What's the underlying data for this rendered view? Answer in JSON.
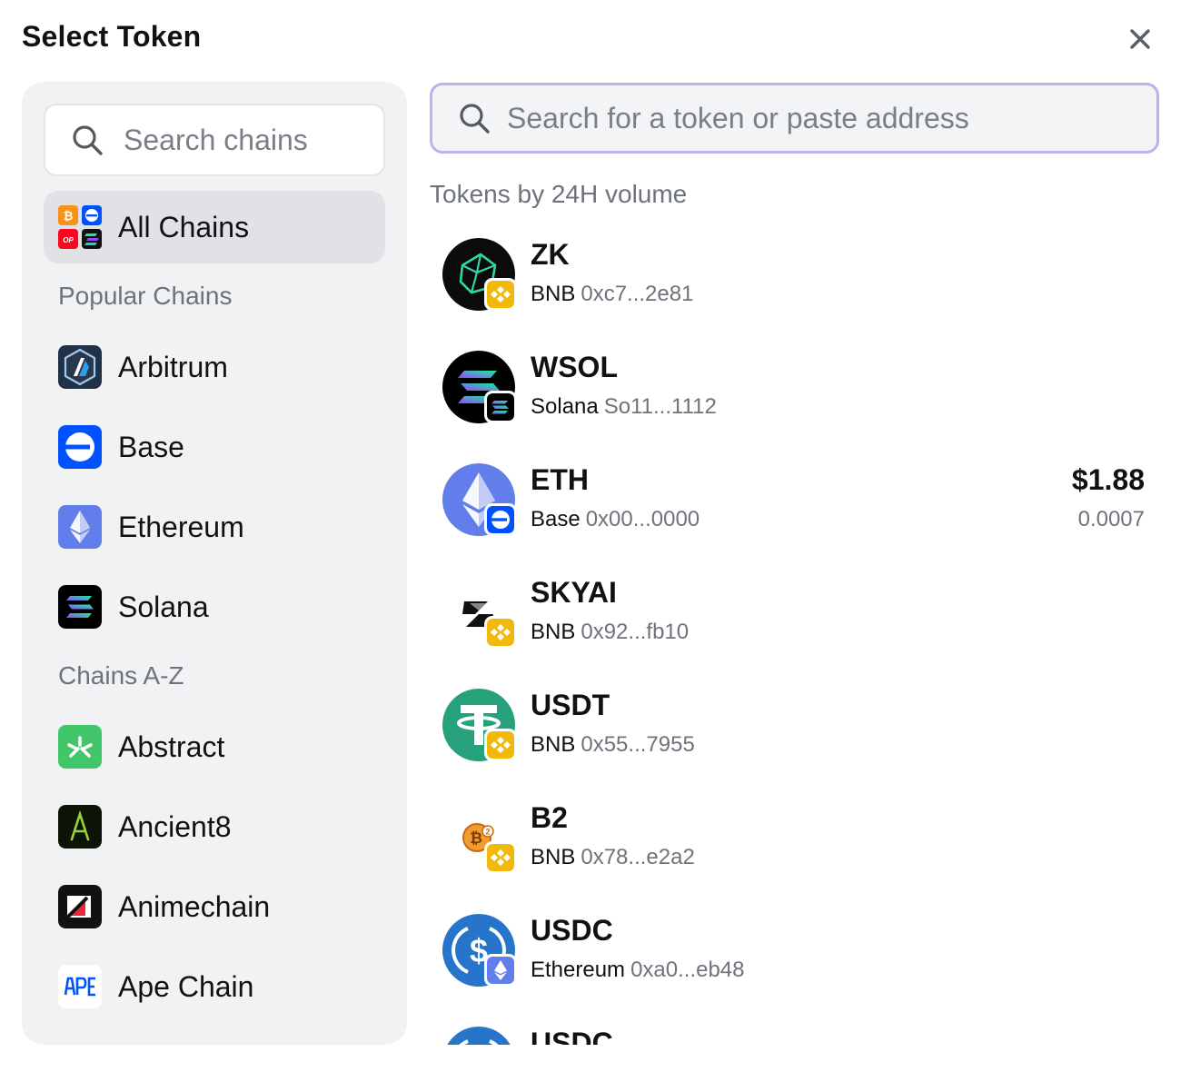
{
  "header": {
    "title": "Select Token"
  },
  "chain_search": {
    "placeholder": "Search chains"
  },
  "token_search": {
    "placeholder": "Search for a token or paste address"
  },
  "chains": {
    "all": {
      "label": "All Chains",
      "selected": true
    },
    "popular_label": "Popular Chains",
    "popular": [
      {
        "label": "Arbitrum",
        "icon": "arbitrum-icon"
      },
      {
        "label": "Base",
        "icon": "base-icon"
      },
      {
        "label": "Ethereum",
        "icon": "ethereum-icon"
      },
      {
        "label": "Solana",
        "icon": "solana-icon"
      }
    ],
    "az_label": "Chains A-Z",
    "az": [
      {
        "label": "Abstract",
        "icon": "abstract-icon"
      },
      {
        "label": "Ancient8",
        "icon": "ancient8-icon"
      },
      {
        "label": "Animechain",
        "icon": "animechain-icon"
      },
      {
        "label": "Ape Chain",
        "icon": "apechain-icon"
      }
    ]
  },
  "tokens_section_label": "Tokens by 24H volume",
  "tokens": [
    {
      "symbol": "ZK",
      "chain": "BNB",
      "address": "0xc7...2e81",
      "usd": "",
      "balance": ""
    },
    {
      "symbol": "WSOL",
      "chain": "Solana",
      "address": "So11...1112",
      "usd": "",
      "balance": ""
    },
    {
      "symbol": "ETH",
      "chain": "Base",
      "address": "0x00...0000",
      "usd": "$1.88",
      "balance": "0.0007"
    },
    {
      "symbol": "SKYAI",
      "chain": "BNB",
      "address": "0x92...fb10",
      "usd": "",
      "balance": ""
    },
    {
      "symbol": "USDT",
      "chain": "BNB",
      "address": "0x55...7955",
      "usd": "",
      "balance": ""
    },
    {
      "symbol": "B2",
      "chain": "BNB",
      "address": "0x78...e2a2",
      "usd": "",
      "balance": ""
    },
    {
      "symbol": "USDC",
      "chain": "Ethereum",
      "address": "0xa0...eb48",
      "usd": "",
      "balance": ""
    },
    {
      "symbol": "USDC",
      "chain": "",
      "address": "",
      "usd": "",
      "balance": ""
    }
  ],
  "colors": {
    "search_focus_border": "#b9b3ee",
    "panel_bg": "#f1f2f4",
    "muted_text": "#6e737b",
    "bnb_yellow": "#f0b90b",
    "base_blue": "#0052ff",
    "eth_purple": "#627eea",
    "usdt_green": "#26a17b",
    "usdc_blue": "#2775ca"
  }
}
